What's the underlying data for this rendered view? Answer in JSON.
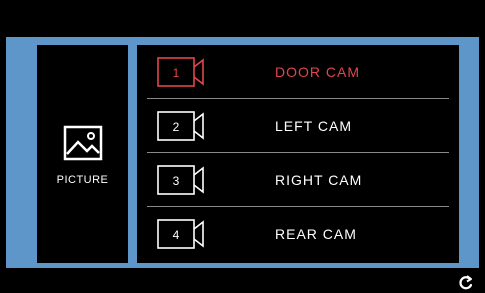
{
  "picture": {
    "label": "PICTURE",
    "icon": "image-icon"
  },
  "cameras": [
    {
      "number": "1",
      "label": "DOOR CAM",
      "active": true
    },
    {
      "number": "2",
      "label": "LEFT CAM",
      "active": false
    },
    {
      "number": "3",
      "label": "RIGHT CAM",
      "active": false
    },
    {
      "number": "4",
      "label": "REAR CAM",
      "active": false
    }
  ],
  "colors": {
    "accent": "#e0474c",
    "background_blue": "#5f96c9",
    "text": "#ffffff"
  },
  "footer": {
    "icon": "refresh-icon"
  }
}
